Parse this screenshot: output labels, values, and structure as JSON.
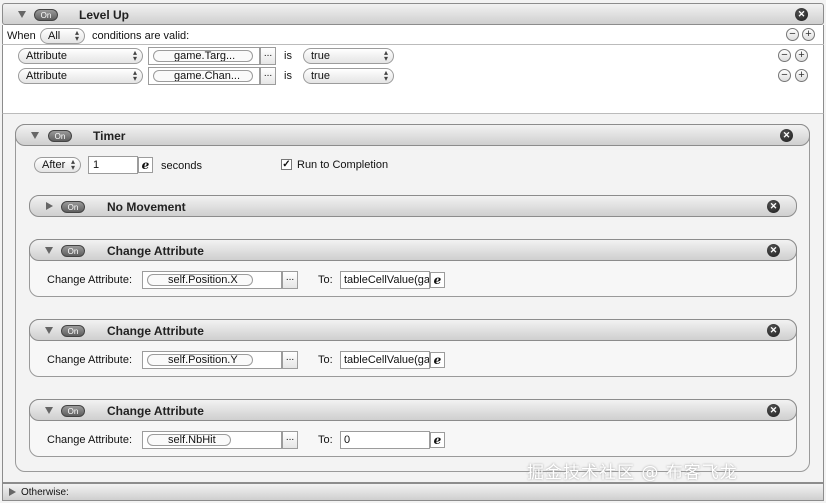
{
  "rule": {
    "on_label": "On",
    "title": "Level Up",
    "when_label": "When",
    "condition_mode": "All",
    "conditions_suffix": "conditions are valid:",
    "conditions": [
      {
        "type": "Attribute",
        "target": "game.Targ...",
        "operator": "is",
        "value": "true"
      },
      {
        "type": "Attribute",
        "target": "game.Chan...",
        "operator": "is",
        "value": "true"
      }
    ],
    "otherwise_label": "Otherwise:"
  },
  "timer": {
    "on_label": "On",
    "title": "Timer",
    "mode": "After",
    "amount": "1",
    "unit": "seconds",
    "run_to_completion_label": "Run to Completion",
    "run_to_completion_checked": "✓"
  },
  "no_movement": {
    "on_label": "On",
    "title": "No Movement"
  },
  "change_attributes": [
    {
      "on_label": "On",
      "title": "Change Attribute",
      "field_label": "Change Attribute:",
      "attribute": "self.Position.X",
      "to_label": "To:",
      "to_value": "tableCellValue(ga"
    },
    {
      "on_label": "On",
      "title": "Change Attribute",
      "field_label": "Change Attribute:",
      "attribute": "self.Position.Y",
      "to_label": "To:",
      "to_value": "tableCellValue(ga"
    },
    {
      "on_label": "On",
      "title": "Change Attribute",
      "field_label": "Change Attribute:",
      "attribute": "self.NbHit",
      "to_label": "To:",
      "to_value": "0"
    }
  ],
  "icons": {
    "close": "✕",
    "dots": "...",
    "expression": "e",
    "minus": "−",
    "plus": "+",
    "popup_arrows": "⌃⌄"
  },
  "watermark": "掘金技术社区 @ 布客飞龙"
}
